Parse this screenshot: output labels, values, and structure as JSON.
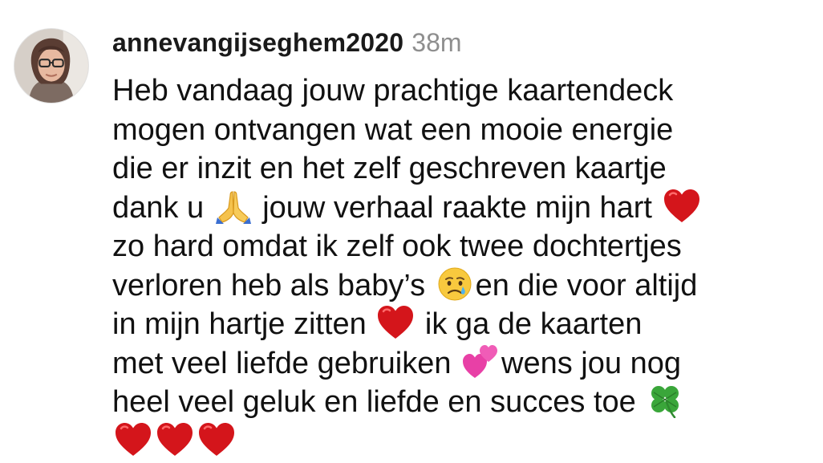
{
  "comment": {
    "username": "annevangijseghem2020",
    "timestamp": "38m",
    "lines": [
      {
        "a": "Heb vandaag jouw prachtige kaartendeck"
      },
      {
        "a": "mogen ontvangen wat een mooie energie"
      },
      {
        "a": "die er inzit en het  zelf geschreven kaartje"
      },
      {
        "a": "dank u ",
        "e1": "folded-hands",
        "b": " jouw verhaal raakte mijn hart ",
        "e2": "red-heart"
      },
      {
        "a": "zo hard omdat ik zelf ook twee dochtertjes"
      },
      {
        "a": "verloren heb als baby’s ",
        "e1": "crying-face",
        "b": "en die voor altijd"
      },
      {
        "a": "in mijn hartje zitten ",
        "e1": "red-heart",
        "b": " ik ga de kaarten"
      },
      {
        "a": "met veel liefde gebruiken ",
        "e1": "two-hearts",
        "b": "wens jou nog"
      },
      {
        "a": "heel veel geluk en liefde en succes toe ",
        "e1": "four-leaf-clover"
      },
      {
        "e1": "red-heart",
        "e2": "red-heart",
        "e3": "red-heart"
      }
    ]
  },
  "colors": {
    "username": "#1a1a1a",
    "timestamp": "#8e8e8e",
    "text": "#111111",
    "heart": "#d4151b"
  }
}
